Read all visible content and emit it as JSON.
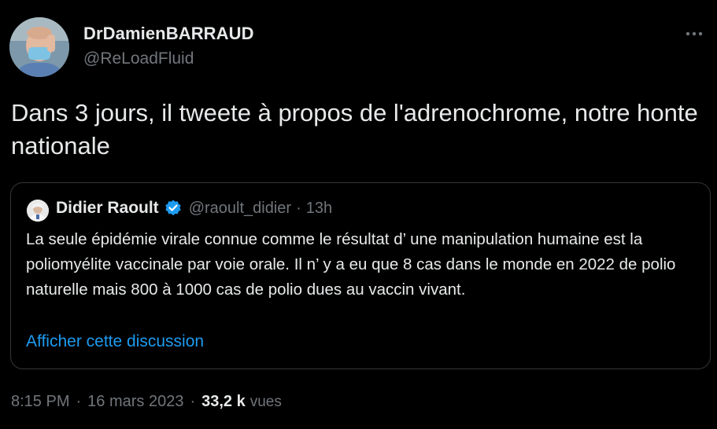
{
  "author": {
    "name": "DrDamienBARRAUD",
    "handle": "@ReLoadFluid"
  },
  "tweet": {
    "text": "Dans 3 jours, il tweete à propos de l'adrenochrome, notre honte nationale"
  },
  "quoted_tweet": {
    "name": "Didier Raoult",
    "handle": "@raoult_didier",
    "separator": "·",
    "time": "13h",
    "text": "La seule épidémie virale connue comme le résultat d’ une manipulation humaine est la poliomyélite vaccinale par voie orale. Il n’ y a eu que 8 cas dans le monde en 2022 de polio naturelle mais 800 à 1000 cas de polio dues au vaccin vivant.",
    "show_thread_label": "Afficher cette discussion"
  },
  "meta": {
    "time": "8:15 PM",
    "separator": "·",
    "date": "16 mars 2023",
    "views_count": "33,2 k",
    "views_label": "vues"
  },
  "icons": {
    "more": "more-horizontal-icon",
    "verified": "verified-badge-icon"
  },
  "colors": {
    "background": "#000000",
    "text": "#e7e9ea",
    "secondary": "#71767b",
    "link": "#1d9bf0",
    "border": "#333639",
    "verified": "#1d9bf0"
  }
}
